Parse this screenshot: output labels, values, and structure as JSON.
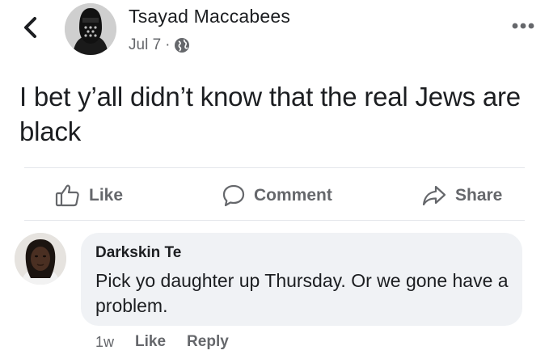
{
  "post": {
    "author": "Tsayad Maccabees",
    "date": "Jul 7",
    "separator": "·",
    "text": "I bet y’all didn’t know that the real Jews are black"
  },
  "actions": {
    "like": "Like",
    "comment": "Comment",
    "share": "Share"
  },
  "comment": {
    "author": "Darkskin Te",
    "text": "Pick yo daughter up Thursday. Or we gone have a problem.",
    "time": "1w",
    "like": "Like",
    "reply": "Reply"
  },
  "icons": {
    "back": "chevron-left-icon",
    "privacy": "globe-icon",
    "more": "more-dots-icon",
    "like": "thumbs-up-icon",
    "comment": "speech-bubble-icon",
    "share": "share-arrow-icon"
  },
  "colors": {
    "text": "#1c1e21",
    "secondary": "#65676b",
    "bubble": "#f0f2f5",
    "divider": "#e4e6eb"
  }
}
